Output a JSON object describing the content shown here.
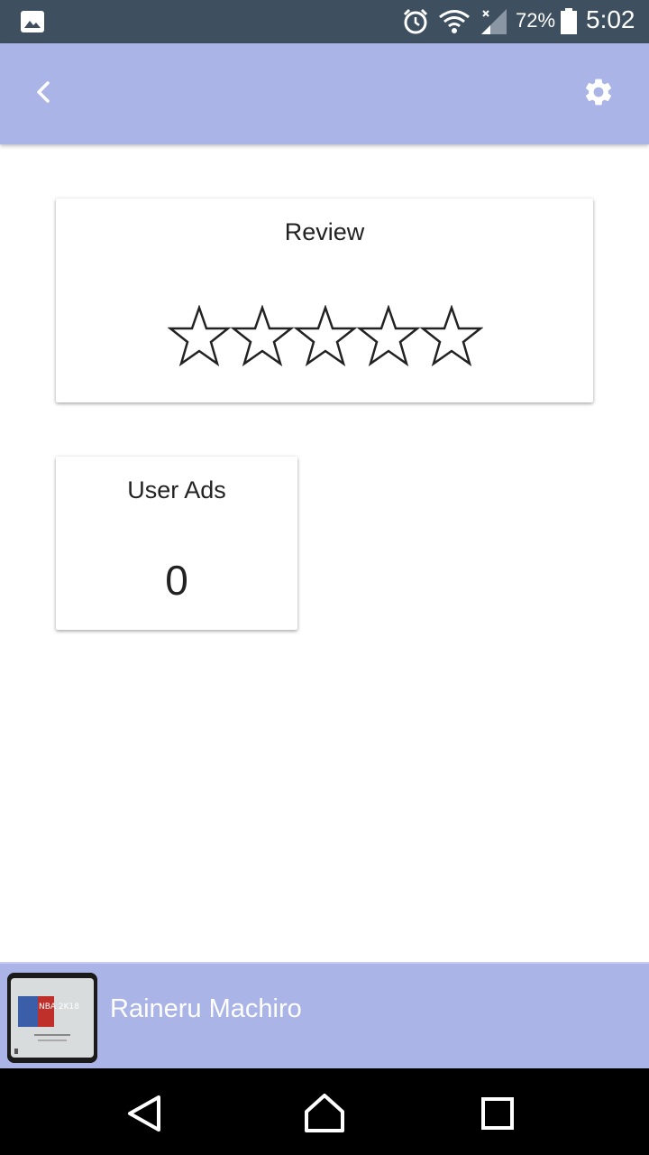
{
  "status_bar": {
    "battery_percent": "72%",
    "time": "5:02",
    "icons": [
      "gallery-icon",
      "alarm-icon",
      "wifi-icon",
      "signal-icon",
      "battery-icon"
    ]
  },
  "app_bar": {
    "back_icon": "chevron-left-icon",
    "settings_icon": "gear-icon",
    "color": "#aab4e6"
  },
  "review": {
    "title": "Review",
    "rating": 0,
    "max_rating": 5
  },
  "user_ads": {
    "title": "User Ads",
    "count": "0"
  },
  "user_bar": {
    "name": "Raineru Machiro",
    "avatar_text": "NBA 2K18"
  },
  "nav_bar": {
    "icons": [
      "nav-back-icon",
      "nav-home-icon",
      "nav-recents-icon"
    ]
  }
}
